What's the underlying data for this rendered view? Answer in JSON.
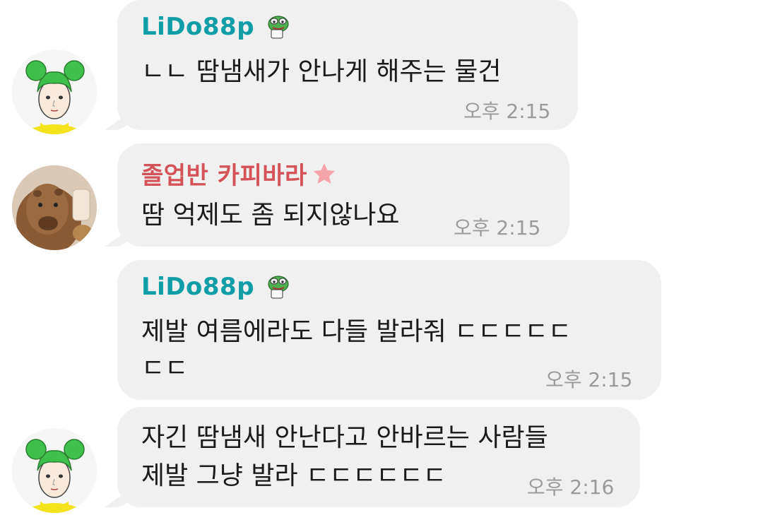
{
  "messages": [
    {
      "sender": "LiDo88p",
      "sender_badge": "pepe-frog-sticker",
      "lines": [
        "ㄴㄴ 땀냄새가 안나게 해주는 물건"
      ],
      "time": "오후 2:15"
    },
    {
      "sender": "졸업반 카피바라",
      "sender_badge": "star-icon",
      "lines": [
        "땀 억제도 좀 되지않나요"
      ],
      "time": "오후 2:15"
    },
    {
      "sender": "LiDo88p",
      "sender_badge": "pepe-frog-sticker",
      "lines": [
        "제발 여름에라도 다들 발라줘 ㄷㄷㄷㄷㄷ",
        "ㄷㄷ"
      ],
      "time": "오후 2:15"
    },
    {
      "sender": "",
      "lines": [
        "자긴 땀냄새 안난다고 안바르는 사람들",
        "제발 그냥 발라 ㄷㄷㄷㄷㄷㄷ"
      ],
      "time": "오후 2:16"
    }
  ],
  "colors": {
    "bubble": "#f0f0f0",
    "sender_teal": "#0f9ea8",
    "sender_red": "#d4535a",
    "time": "#9a9a9a"
  }
}
